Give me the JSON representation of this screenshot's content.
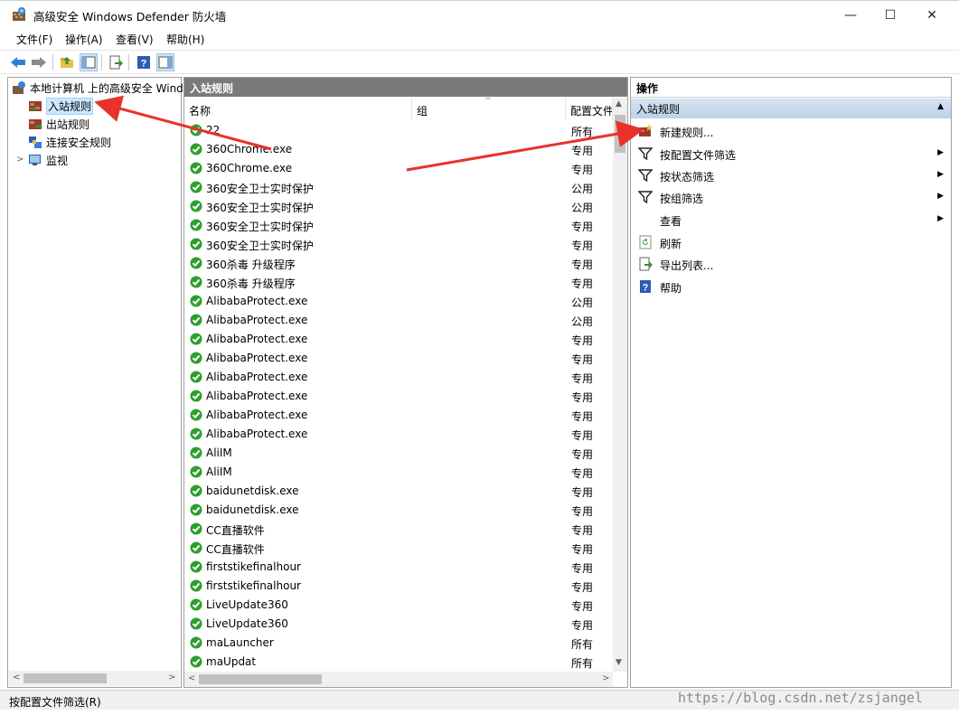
{
  "window": {
    "title": "高级安全 Windows Defender 防火墙",
    "minimize_glyph": "—",
    "maximize_glyph": "☐",
    "close_glyph": "✕"
  },
  "menu": [
    "文件(F)",
    "操作(A)",
    "查看(V)",
    "帮助(H)"
  ],
  "tree": {
    "root": "本地计算机 上的高级安全 Windows",
    "items": [
      "入站规则",
      "出站规则",
      "连接安全规则",
      "监视"
    ]
  },
  "main": {
    "title": "入站规则",
    "columns": [
      "名称",
      "组",
      "配置文件"
    ],
    "rows": [
      {
        "name": "22",
        "profile": "所有"
      },
      {
        "name": "360Chrome.exe",
        "profile": "专用"
      },
      {
        "name": "360Chrome.exe",
        "profile": "专用"
      },
      {
        "name": "360安全卫士实时保护",
        "profile": "公用"
      },
      {
        "name": "360安全卫士实时保护",
        "profile": "公用"
      },
      {
        "name": "360安全卫士实时保护",
        "profile": "专用"
      },
      {
        "name": "360安全卫士实时保护",
        "profile": "专用"
      },
      {
        "name": "360杀毒 升级程序",
        "profile": "专用"
      },
      {
        "name": "360杀毒 升级程序",
        "profile": "专用"
      },
      {
        "name": "AlibabaProtect.exe",
        "profile": "公用"
      },
      {
        "name": "AlibabaProtect.exe",
        "profile": "公用"
      },
      {
        "name": "AlibabaProtect.exe",
        "profile": "专用"
      },
      {
        "name": "AlibabaProtect.exe",
        "profile": "专用"
      },
      {
        "name": "AlibabaProtect.exe",
        "profile": "专用"
      },
      {
        "name": "AlibabaProtect.exe",
        "profile": "专用"
      },
      {
        "name": "AlibabaProtect.exe",
        "profile": "专用"
      },
      {
        "name": "AlibabaProtect.exe",
        "profile": "专用"
      },
      {
        "name": "AliIM",
        "profile": "专用"
      },
      {
        "name": "AliIM",
        "profile": "专用"
      },
      {
        "name": "baidunetdisk.exe",
        "profile": "专用"
      },
      {
        "name": "baidunetdisk.exe",
        "profile": "专用"
      },
      {
        "name": "CC直播软件",
        "profile": "专用"
      },
      {
        "name": "CC直播软件",
        "profile": "专用"
      },
      {
        "name": "firststikefinalhour",
        "profile": "专用"
      },
      {
        "name": "firststikefinalhour",
        "profile": "专用"
      },
      {
        "name": "LiveUpdate360",
        "profile": "专用"
      },
      {
        "name": "LiveUpdate360",
        "profile": "专用"
      },
      {
        "name": "maLauncher",
        "profile": "所有"
      },
      {
        "name": "maUpdat",
        "profile": "所有"
      }
    ]
  },
  "actions": {
    "title": "操作",
    "section": "入站规则",
    "items": [
      {
        "label": "新建规则...",
        "icon": "new-rule-icon",
        "submenu": false
      },
      {
        "label": "按配置文件筛选",
        "icon": "filter-icon",
        "submenu": true
      },
      {
        "label": "按状态筛选",
        "icon": "filter-icon",
        "submenu": true
      },
      {
        "label": "按组筛选",
        "icon": "filter-icon",
        "submenu": true
      },
      {
        "label": "查看",
        "icon": "",
        "submenu": true
      },
      {
        "label": "刷新",
        "icon": "refresh-icon",
        "submenu": false
      },
      {
        "label": "导出列表...",
        "icon": "export-icon",
        "submenu": false
      },
      {
        "label": "帮助",
        "icon": "help-icon",
        "submenu": false
      }
    ]
  },
  "status": "按配置文件筛选(R)",
  "watermark": "https://blog.csdn.net/zsjangel",
  "colors": {
    "accent_selected": "#cce8ff",
    "header_gray": "#7a7a7a",
    "check_green": "#2e9e2e",
    "arrow_red": "#e8322b"
  }
}
